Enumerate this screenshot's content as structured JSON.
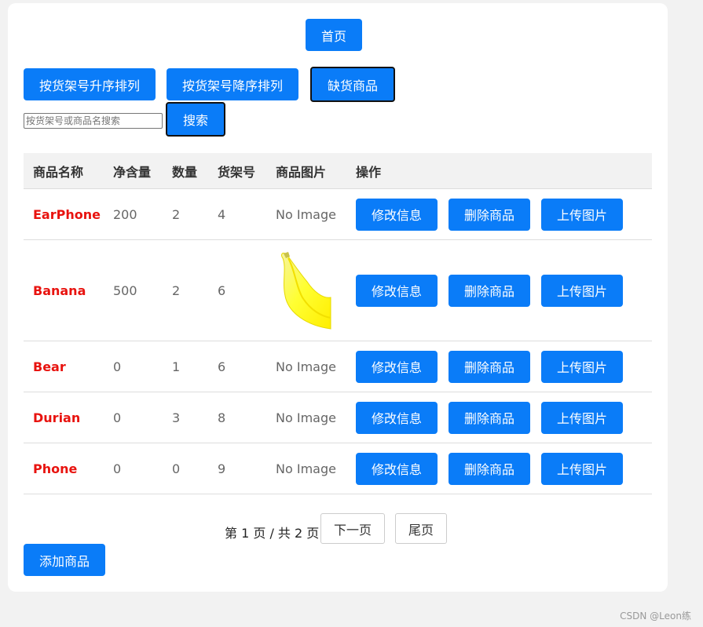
{
  "nav": {
    "home_label": "首页"
  },
  "toolbar": {
    "sort_asc_label": "按货架号升序排列",
    "sort_desc_label": "按货架号降序排列",
    "out_of_stock_label": "缺货商品",
    "search_placeholder": "按货架号或商品名搜索",
    "search_label": "搜索"
  },
  "table": {
    "headers": [
      "商品名称",
      "净含量",
      "数量",
      "货架号",
      "商品图片",
      "操作"
    ],
    "no_image_text": "No Image",
    "actions": {
      "edit": "修改信息",
      "delete": "删除商品",
      "upload": "上传图片"
    },
    "rows": [
      {
        "name": "EarPhone",
        "net": "200",
        "qty": "2",
        "shelf": "4",
        "image": "No Image"
      },
      {
        "name": "Banana",
        "net": "500",
        "qty": "2",
        "shelf": "6",
        "image": "banana-image"
      },
      {
        "name": "Bear",
        "net": "0",
        "qty": "1",
        "shelf": "6",
        "image": "No Image"
      },
      {
        "name": "Durian",
        "net": "0",
        "qty": "3",
        "shelf": "8",
        "image": "No Image"
      },
      {
        "name": "Phone",
        "net": "0",
        "qty": "0",
        "shelf": "9",
        "image": "No Image"
      }
    ]
  },
  "pagination": {
    "info": "第 1 页 / 共 2 页",
    "next_label": "下一页",
    "last_label": "尾页"
  },
  "add_button_label": "添加商品",
  "watermark": "CSDN @Leon练",
  "colors": {
    "accent": "#0a7cf8",
    "product_name": "#e8130f",
    "background": "#f2f2f2"
  }
}
